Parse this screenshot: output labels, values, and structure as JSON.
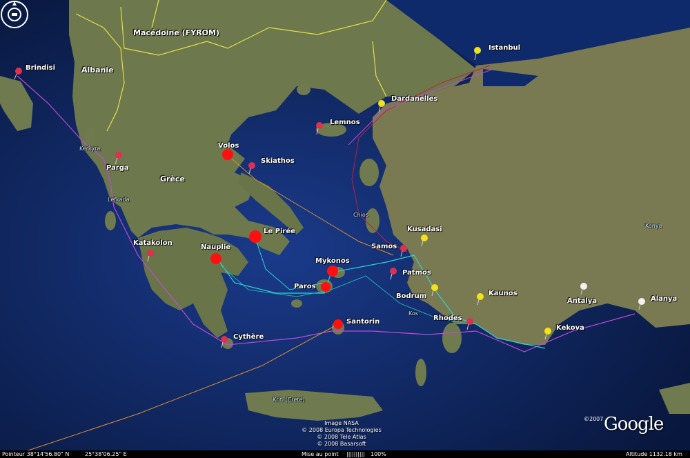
{
  "labels": {
    "countries": {
      "macedonia": "Macédoine (FYROM)",
      "albania": "Albanie",
      "greece": "Grèce",
      "konya": "Konya"
    },
    "ports": {
      "brindisi": "Brindisi",
      "istanbul": "Istanbul",
      "dardanelles": "Dardanelles",
      "lemnos": "Lemnos",
      "volos": "Volos",
      "skiathos": "Skiathos",
      "parga": "Parga",
      "kusadasi": "Kusadasi",
      "samos": "Samos",
      "patmos": "Patmos",
      "le_piree": "Le Pirée",
      "nauplie": "Nauplie",
      "katakolon": "Katakolon",
      "mykonos": "Mykonos",
      "paros": "Paros",
      "santorin": "Santorin",
      "bodrum": "Bodrum",
      "kaunos": "Kaunos",
      "rhodes": "Rhodes",
      "kekova": "Kekova",
      "antalya": "Antalya",
      "alanya": "Alanya",
      "cythere": "Cythère"
    },
    "small": {
      "kerkyra": "Kerkyra",
      "lefkada": "Lefkada",
      "chios": "Chios",
      "kos": "Kos",
      "crete": "Kriti (Crete)"
    }
  },
  "credits": [
    "Image NASA",
    "© 2008 Europa Technologies",
    "© 2008 Tele Atlas",
    "© 2008 Basarsoft"
  ],
  "brand": {
    "year": "©2007",
    "logo": "Google"
  },
  "statusbar": {
    "pointer": "Pointeur 38°14'56.80\" N",
    "longitude": "25°38'06.25\" E",
    "streaming_label": "Mise au point",
    "streaming_bar": "||||||||||",
    "streaming_pct": "100%",
    "altitude": "Altitude  1132.18 km"
  },
  "colors": {
    "sea": "#0b1d4a",
    "land": "#6f7a4e",
    "border": "#e8e04a",
    "route_purple": "#c04ad8",
    "route_cyan": "#2ad6d6",
    "route_orange": "#e0902a",
    "route_red": "#c02040",
    "pin_red": "#e03050",
    "pin_yellow": "#f2e21a",
    "pin_white": "#f2f2f2",
    "dot_red": "#ff1010"
  }
}
